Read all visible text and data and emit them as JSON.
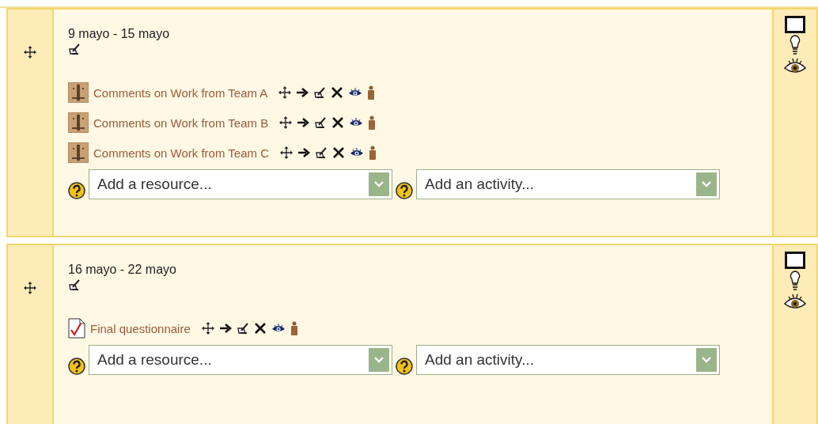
{
  "sections": [
    {
      "dates": "9 mayo - 15 mayo",
      "activities": [
        {
          "kind": "forum",
          "name": "Comments on Work from Team A"
        },
        {
          "kind": "forum",
          "name": "Comments on Work from Team B"
        },
        {
          "kind": "forum",
          "name": "Comments on Work from Team C"
        }
      ],
      "resource_select": {
        "value": "Add a resource..."
      },
      "activity_select": {
        "value": "Add an activity..."
      }
    },
    {
      "dates": "16 mayo - 22 mayo",
      "activities": [
        {
          "kind": "quiz",
          "name": "Final questionnaire"
        }
      ],
      "resource_select": {
        "value": "Add a resource..."
      },
      "activity_select": {
        "value": "Add an activity..."
      }
    }
  ]
}
